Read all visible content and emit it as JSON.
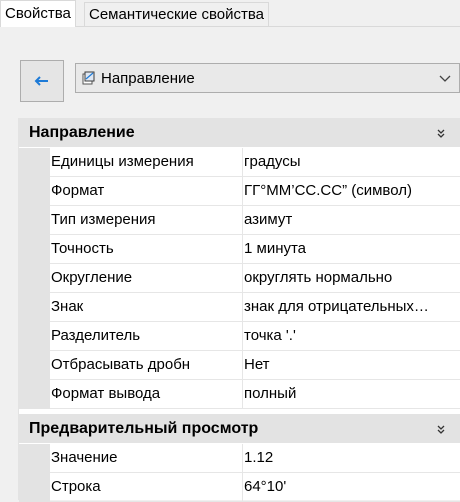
{
  "tabs": {
    "properties": "Свойства",
    "semantic": "Семантические свойства"
  },
  "combo": {
    "selected": "Направление"
  },
  "sections": [
    {
      "title": "Направление",
      "rows": [
        {
          "name": "Единицы измерения",
          "value": "градусы"
        },
        {
          "name": "Формат",
          "value": "ГГ°ММ’СС.СС” (символ)"
        },
        {
          "name": "Тип измерения",
          "value": "азимут"
        },
        {
          "name": "Точность",
          "value": "1 минута"
        },
        {
          "name": "Округление",
          "value": "округлять нормально"
        },
        {
          "name": "Знак",
          "value": "знак для отрицательных…"
        },
        {
          "name": "Разделитель",
          "value": "точка '.'"
        },
        {
          "name": "Отбрасывать дробн",
          "value": "Нет"
        },
        {
          "name": "Формат вывода",
          "value": "полный"
        }
      ]
    },
    {
      "title": "Предварительный просмотр",
      "rows": [
        {
          "name": "Значение",
          "value": "1.12"
        },
        {
          "name": "Строка",
          "value": "64°10'"
        }
      ]
    }
  ],
  "icons": {
    "back": "arrow-left-icon",
    "combo": "direction-icon",
    "chevron": "chevron-down-icon",
    "collapse": "double-chevron-up-icon"
  },
  "colors": {
    "accent": "#1e7bd7",
    "section_bg": "#e3e3e3",
    "panel_bg": "#f0f0f0"
  }
}
